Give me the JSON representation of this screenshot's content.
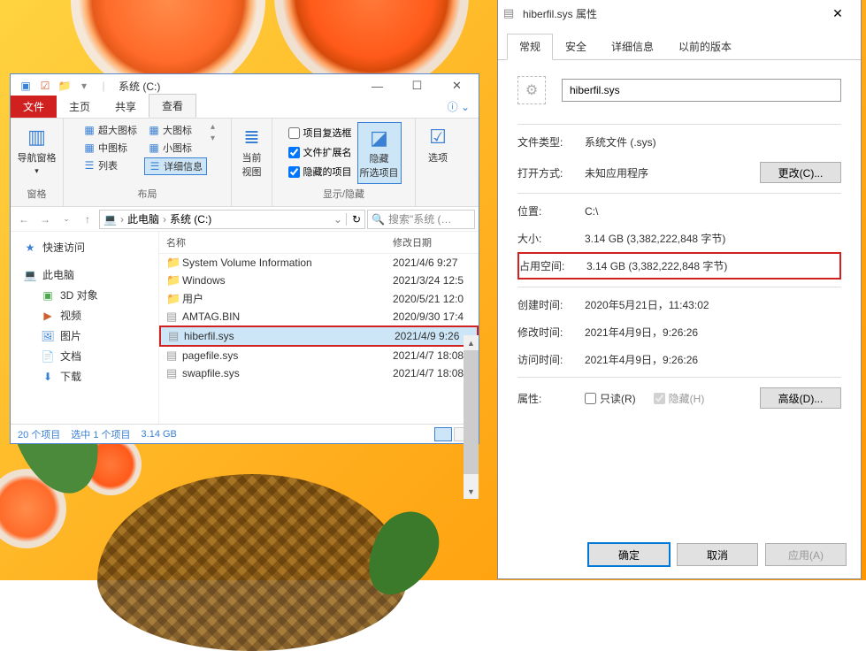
{
  "explorer": {
    "title": "系统 (C:)",
    "win_min": "—",
    "win_max": "☐",
    "win_close": "✕",
    "tabs": {
      "file": "文件",
      "home": "主页",
      "share": "共享",
      "view": "查看"
    },
    "ribbon": {
      "navpane": "导航窗格",
      "pane_group": "窗格",
      "xl": "超大图标",
      "lg": "大图标",
      "md": "中图标",
      "sm": "小图标",
      "list": "列表",
      "details": "详细信息",
      "layout_group": "布局",
      "curview": "当前\n视图",
      "chk1": "项目复选框",
      "chk2": "文件扩展名",
      "chk3": "隐藏的项目",
      "hide": "隐藏\n所选项目",
      "showhide_group": "显示/隐藏",
      "options": "选项"
    },
    "breadcrumb": {
      "pc": "此电脑",
      "loc": "系统 (C:)",
      "sep": "›",
      "refresh": "↻"
    },
    "search_placeholder": "搜索\"系统 (…",
    "sidebar": {
      "quick": "快速访问",
      "pc": "此电脑",
      "d3": "3D 对象",
      "video": "视频",
      "pic": "图片",
      "doc": "文档",
      "dl": "下载"
    },
    "cols": {
      "name": "名称",
      "date": "修改日期"
    },
    "files": [
      {
        "icon": "folder",
        "name": "System Volume Information",
        "date": "2021/4/6 9:27"
      },
      {
        "icon": "folder",
        "name": "Windows",
        "date": "2021/3/24 12:5"
      },
      {
        "icon": "folder",
        "name": "用户",
        "date": "2020/5/21 12:0"
      },
      {
        "icon": "file",
        "name": "AMTAG.BIN",
        "date": "2020/9/30 17:4"
      },
      {
        "icon": "file",
        "name": "hiberfil.sys",
        "date": "2021/4/9 9:26"
      },
      {
        "icon": "file",
        "name": "pagefile.sys",
        "date": "2021/4/7 18:08"
      },
      {
        "icon": "file",
        "name": "swapfile.sys",
        "date": "2021/4/7 18:08"
      }
    ],
    "status": {
      "items": "20 个项目",
      "selected": "选中 1 个项目",
      "size": "3.14 GB"
    }
  },
  "props": {
    "title": "hiberfil.sys 属性",
    "close": "✕",
    "tabs": {
      "general": "常规",
      "security": "安全",
      "details": "详细信息",
      "prev": "以前的版本"
    },
    "filename": "hiberfil.sys",
    "rows": {
      "type_lbl": "文件类型:",
      "type_val": "系统文件 (.sys)",
      "open_lbl": "打开方式:",
      "open_val": "未知应用程序",
      "change_btn": "更改(C)...",
      "loc_lbl": "位置:",
      "loc_val": "C:\\",
      "size_lbl": "大小:",
      "size_val": "3.14 GB (3,382,222,848 字节)",
      "disk_lbl": "占用空间:",
      "disk_val": "3.14 GB (3,382,222,848 字节)",
      "created_lbl": "创建时间:",
      "created_val": "2020年5月21日，11:43:02",
      "modified_lbl": "修改时间:",
      "modified_val": "2021年4月9日，9:26:26",
      "accessed_lbl": "访问时间:",
      "accessed_val": "2021年4月9日，9:26:26",
      "attr_lbl": "属性:",
      "readonly": "只读(R)",
      "hidden": "隐藏(H)",
      "adv_btn": "高级(D)..."
    },
    "footer": {
      "ok": "确定",
      "cancel": "取消",
      "apply": "应用(A)"
    }
  }
}
